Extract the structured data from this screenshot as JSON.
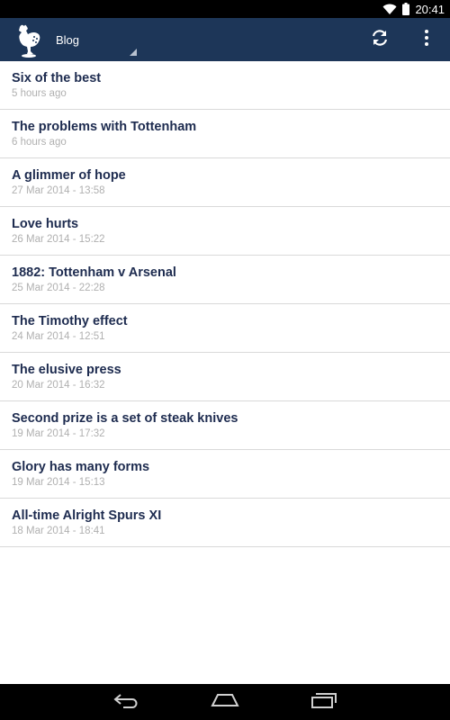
{
  "status_bar": {
    "time": "20:41",
    "icons": [
      "wifi-icon",
      "battery-icon"
    ]
  },
  "action_bar": {
    "logo_icon": "cockerel-logo-icon",
    "section": "Blog",
    "actions": [
      "refresh-icon",
      "overflow-menu-icon"
    ],
    "color": "#1d3658"
  },
  "posts": [
    {
      "title": "Six of the best",
      "date": "5 hours ago"
    },
    {
      "title": "The problems with Tottenham",
      "date": "6 hours ago"
    },
    {
      "title": "A glimmer of hope",
      "date": "27 Mar 2014 - 13:58"
    },
    {
      "title": "Love hurts",
      "date": "26 Mar 2014 - 15:22"
    },
    {
      "title": "1882: Tottenham v Arsenal",
      "date": "25 Mar 2014 - 22:28"
    },
    {
      "title": "The Timothy effect",
      "date": "24 Mar 2014 - 12:51"
    },
    {
      "title": "The elusive press",
      "date": "20 Mar 2014 - 16:32"
    },
    {
      "title": "Second prize is a set of steak knives",
      "date": "19 Mar 2014 - 17:32"
    },
    {
      "title": "Glory has many forms",
      "date": "19 Mar 2014 - 15:13"
    },
    {
      "title": "All-time Alright Spurs XI",
      "date": "18 Mar 2014 - 18:41"
    }
  ],
  "nav_bar": {
    "buttons": [
      "back-icon",
      "home-icon",
      "recent-apps-icon"
    ]
  }
}
